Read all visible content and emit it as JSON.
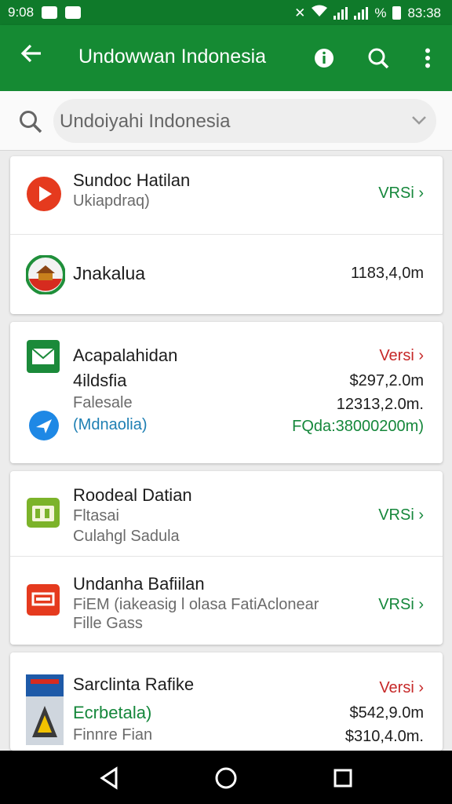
{
  "status": {
    "time": "9:08",
    "clock": "83:38",
    "percent": "%"
  },
  "appbar": {
    "title": "Undowwan Indonesia",
    "icons": [
      "arrow-back-icon",
      "info-icon",
      "search-gear-icon",
      "more-vert-icon"
    ]
  },
  "search": {
    "value": "Undoiyahi Indonesia"
  },
  "colors": {
    "primary": "#158a33",
    "status": "#0f7a2a",
    "green_text": "#15873b",
    "red_text": "#c62828"
  },
  "cards": [
    {
      "rows": [
        {
          "icon": "play-icon",
          "title": "Sundoc Hatilan",
          "sub": "Ukiapdraq)",
          "right": "VRSi"
        },
        {
          "icon": "home-badge-icon",
          "title": "Jnakalua",
          "right": "1183,4,0m"
        }
      ]
    },
    {
      "rows": [
        {
          "icon": "mail-icon",
          "lines": [
            "Acapalahidan",
            "4ildsfia",
            "Falesale",
            "(Mdnaolia)"
          ],
          "right_lines": [
            "Versi",
            "$297,2.0m",
            "12313,2.0m.",
            "FQda:38000200m)"
          ]
        }
      ]
    },
    {
      "rows": [
        {
          "icon": "calendar-icon",
          "title": "Roodeal Datian",
          "sub": "Fltasai",
          "sub2": "Culahgl Sadula",
          "right": "VRSi"
        },
        {
          "icon": "file-icon",
          "title": "Undanha Bafiilan",
          "sub": "FiEM (iakeasig l olasa FatiAclonear",
          "sub2": "Fille Gass",
          "right": "VRSi"
        }
      ]
    },
    {
      "rows": [
        {
          "icon": "book-cover-icon",
          "title": "Sarclinta Rafike",
          "sub": "Ecrbetala)",
          "sub2": "Finnre Fian",
          "right_lines": [
            "Versi",
            "$542,9.0m",
            "$310,4.0m."
          ]
        }
      ]
    }
  ]
}
